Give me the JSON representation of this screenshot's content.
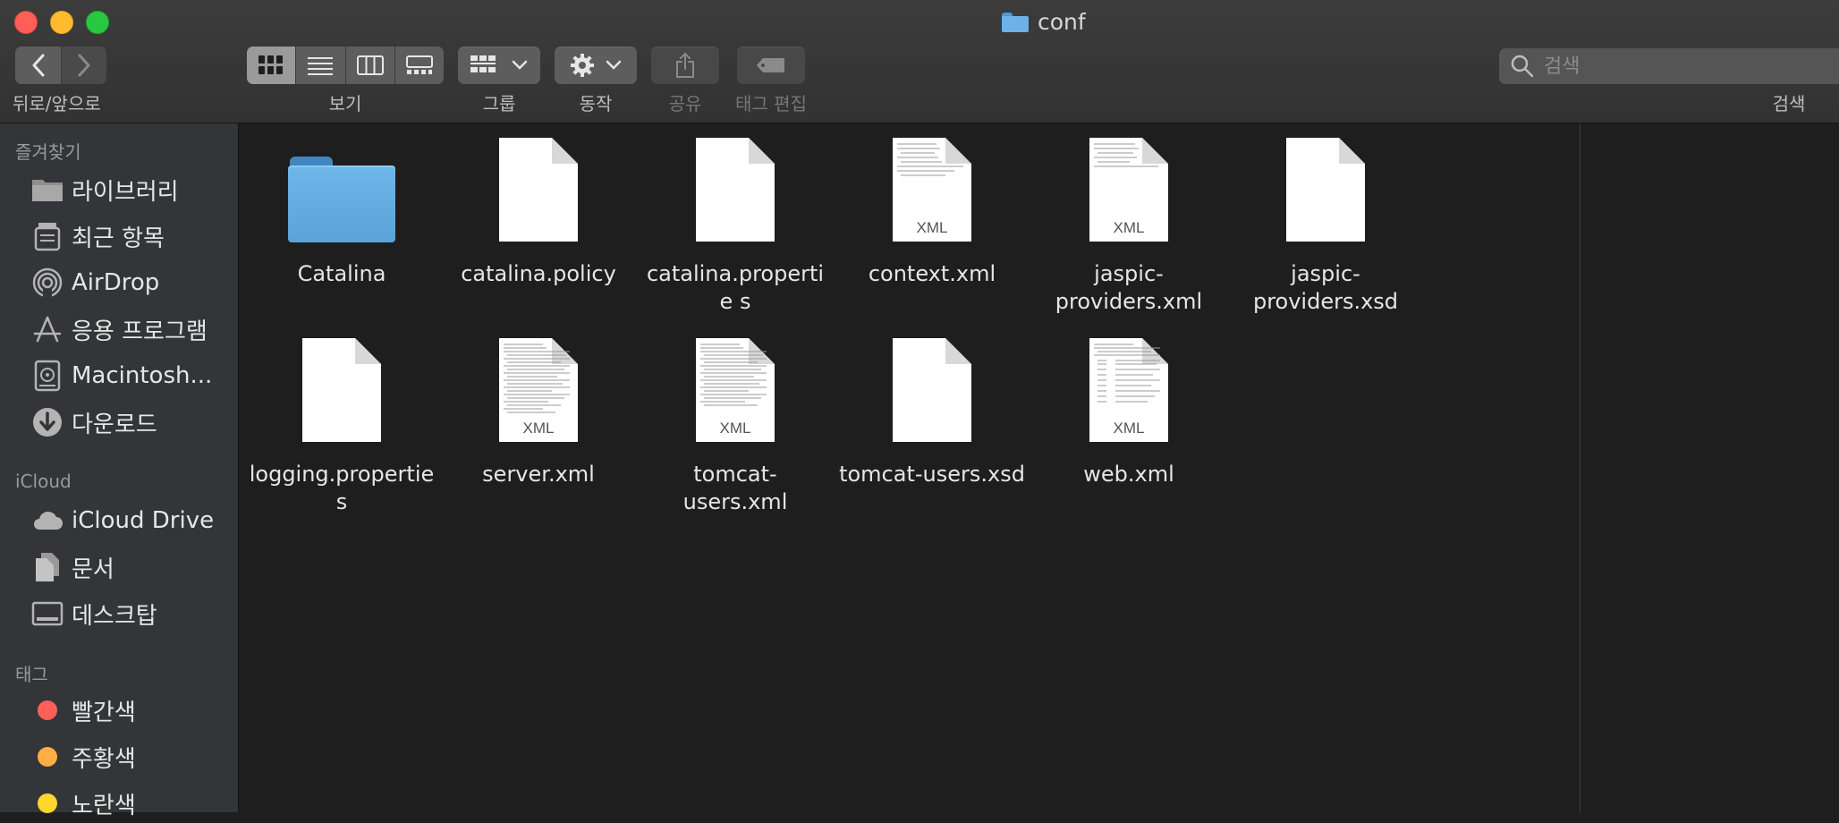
{
  "window": {
    "title": "conf"
  },
  "toolbar": {
    "nav_label": "뒤로/앞으로",
    "view_label": "보기",
    "group_label": "그룹",
    "action_label": "동작",
    "share_label": "공유",
    "tag_edit_label": "태그 편집",
    "search_label": "검색",
    "search_placeholder": "검색",
    "active_view": "icon"
  },
  "sidebar": {
    "favorites_header": "즐겨찾기",
    "favorites": [
      {
        "label": "라이브러리",
        "icon": "folder-icon"
      },
      {
        "label": "최근 항목",
        "icon": "recents-icon"
      },
      {
        "label": "AirDrop",
        "icon": "airdrop-icon"
      },
      {
        "label": "응용 프로그램",
        "icon": "applications-icon"
      },
      {
        "label": "Macintosh...",
        "icon": "hard-disk-icon"
      },
      {
        "label": "다운로드",
        "icon": "downloads-icon"
      }
    ],
    "icloud_header": "iCloud",
    "icloud": [
      {
        "label": "iCloud Drive",
        "icon": "cloud-icon"
      },
      {
        "label": "문서",
        "icon": "documents-icon"
      },
      {
        "label": "데스크탑",
        "icon": "desktop-icon"
      }
    ],
    "tags_header": "태그",
    "tags": [
      {
        "label": "빨간색",
        "color": "#ff5f57"
      },
      {
        "label": "주황색",
        "color": "#ffae45"
      },
      {
        "label": "노란색",
        "color": "#ffd52e"
      }
    ]
  },
  "files": [
    {
      "name": "Catalina",
      "kind": "folder"
    },
    {
      "name": "catalina.policy",
      "kind": "blank"
    },
    {
      "name": "catalina.propertie s",
      "kind": "blank"
    },
    {
      "name": "context.xml",
      "kind": "xml"
    },
    {
      "name": "jaspic-providers.xml",
      "kind": "xml"
    },
    {
      "name": "jaspic-providers.xsd",
      "kind": "blank"
    },
    {
      "name": "logging.propertie s",
      "kind": "blank"
    },
    {
      "name": "server.xml",
      "kind": "xml"
    },
    {
      "name": "tomcat-users.xml",
      "kind": "xml"
    },
    {
      "name": "tomcat-users.xsd",
      "kind": "blank"
    },
    {
      "name": "web.xml",
      "kind": "xml"
    }
  ],
  "xml_badge": "XML"
}
